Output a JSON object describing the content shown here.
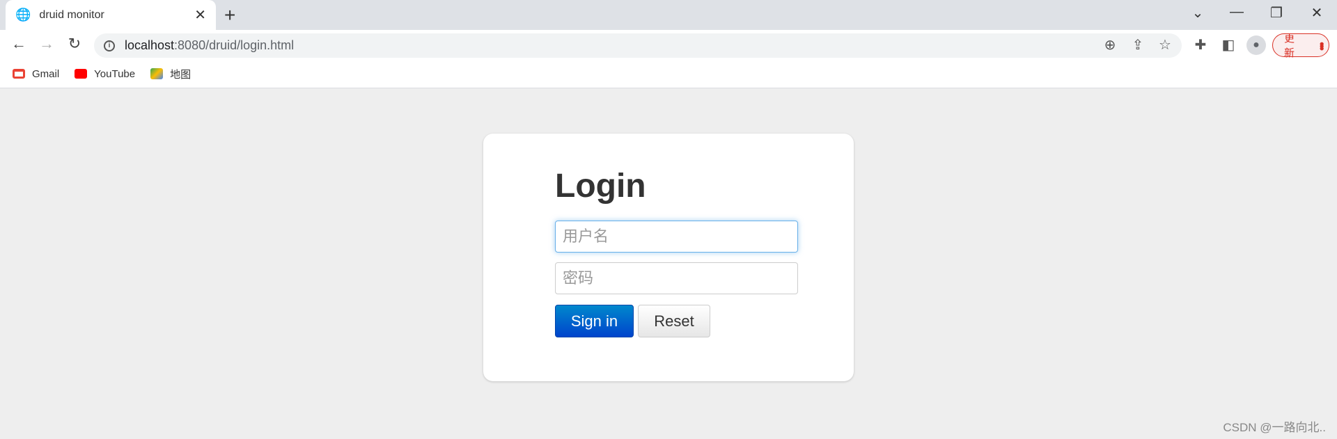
{
  "browser": {
    "tab_title": "druid monitor",
    "url_host": "localhost",
    "url_path": ":8080/druid/login.html",
    "update_label": "更新",
    "bookmarks": [
      {
        "label": "Gmail",
        "color": "#ea4335"
      },
      {
        "label": "YouTube",
        "color": "#ff0000"
      },
      {
        "label": "地图",
        "color": "#34a853"
      }
    ]
  },
  "login": {
    "title": "Login",
    "username_placeholder": "用户名",
    "password_placeholder": "密码",
    "signin_label": "Sign in",
    "reset_label": "Reset",
    "accent": "#0066cc"
  },
  "watermark": "CSDN @一路向北.."
}
